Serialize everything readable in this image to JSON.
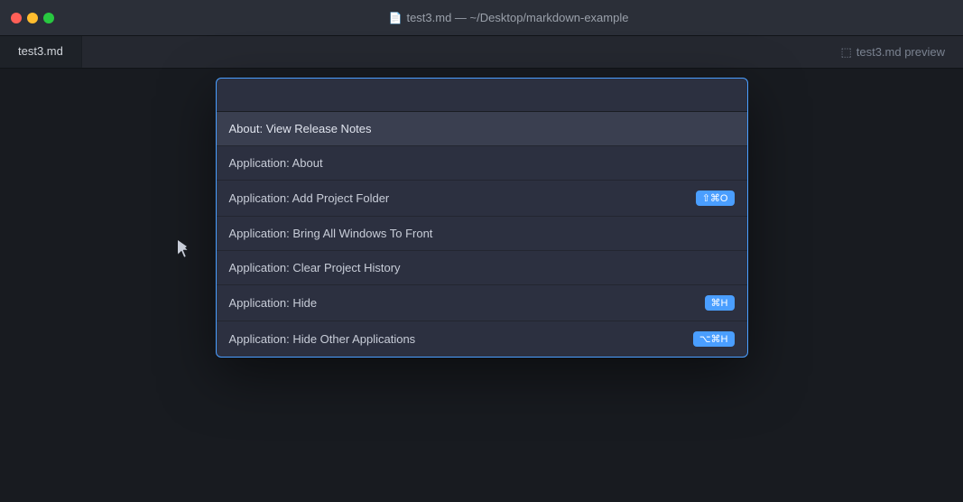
{
  "titleBar": {
    "title": "test3.md — ~/Desktop/markdown-example",
    "fileIcon": "📄"
  },
  "tabs": [
    {
      "label": "test3.md",
      "active": true
    },
    {
      "label": "test3.md preview",
      "active": false,
      "icon": "⬚"
    }
  ],
  "commandPalette": {
    "searchPlaceholder": "",
    "items": [
      {
        "id": "about-release",
        "label": "About: View Release Notes",
        "shortcut": null,
        "isHeader": true
      },
      {
        "id": "app-about",
        "label": "Application: About",
        "shortcut": null
      },
      {
        "id": "app-add-project",
        "label": "Application: Add Project Folder",
        "shortcut": "⇧⌘O"
      },
      {
        "id": "app-bring-front",
        "label": "Application: Bring All Windows To Front",
        "shortcut": null
      },
      {
        "id": "app-clear-history",
        "label": "Application: Clear Project History",
        "shortcut": null
      },
      {
        "id": "app-hide",
        "label": "Application: Hide",
        "shortcut": "⌘H"
      },
      {
        "id": "app-hide-other",
        "label": "Application: Hide Other Applications",
        "shortcut": "⌥⌘H"
      }
    ]
  }
}
